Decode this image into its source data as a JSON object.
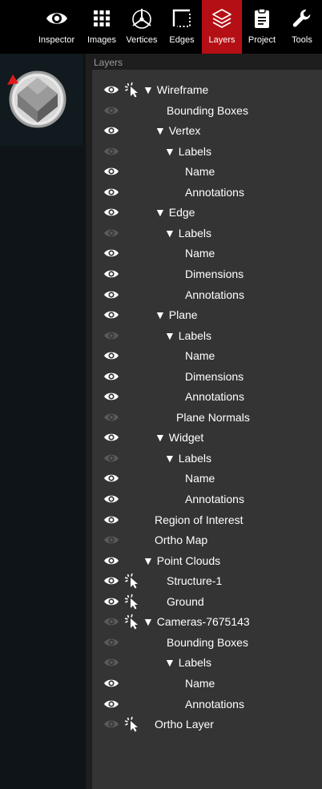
{
  "toolbar": {
    "tabs": [
      {
        "label": "Inspector",
        "icon": "eye-icon",
        "active": false
      },
      {
        "label": "Images",
        "icon": "grid-icon",
        "active": false
      },
      {
        "label": "Vertices",
        "icon": "vertices-icon",
        "active": false
      },
      {
        "label": "Edges",
        "icon": "edges-icon",
        "active": false
      },
      {
        "label": "Layers",
        "icon": "layers-icon",
        "active": true
      },
      {
        "label": "Project",
        "icon": "clipboard-icon",
        "active": false
      },
      {
        "label": "Tools",
        "icon": "wrench-icon",
        "active": false
      }
    ],
    "active_color": "#b40f14"
  },
  "layers": {
    "title": "Layers",
    "items": [
      {
        "label": "Wireframe",
        "arrow": "▼",
        "visible": true,
        "selectable": true
      },
      {
        "label": "Bounding Boxes",
        "arrow": "",
        "visible": false,
        "selectable": false
      },
      {
        "label": "Vertex",
        "arrow": "▼",
        "visible": true,
        "selectable": false
      },
      {
        "label": "Labels",
        "arrow": "▼",
        "visible": false,
        "selectable": false
      },
      {
        "label": "Name",
        "arrow": "",
        "visible": true,
        "selectable": false
      },
      {
        "label": "Annotations",
        "arrow": "",
        "visible": true,
        "selectable": false
      },
      {
        "label": "Edge",
        "arrow": "▼",
        "visible": true,
        "selectable": false
      },
      {
        "label": "Labels",
        "arrow": "▼",
        "visible": false,
        "selectable": false
      },
      {
        "label": "Name",
        "arrow": "",
        "visible": true,
        "selectable": false
      },
      {
        "label": "Dimensions",
        "arrow": "",
        "visible": true,
        "selectable": false
      },
      {
        "label": "Annotations",
        "arrow": "",
        "visible": true,
        "selectable": false
      },
      {
        "label": "Plane",
        "arrow": "▼",
        "visible": true,
        "selectable": false
      },
      {
        "label": "Labels",
        "arrow": "▼",
        "visible": false,
        "selectable": false
      },
      {
        "label": "Name",
        "arrow": "",
        "visible": true,
        "selectable": false
      },
      {
        "label": "Dimensions",
        "arrow": "",
        "visible": true,
        "selectable": false
      },
      {
        "label": "Annotations",
        "arrow": "",
        "visible": true,
        "selectable": false
      },
      {
        "label": "Plane Normals",
        "arrow": "",
        "visible": false,
        "selectable": false
      },
      {
        "label": "Widget",
        "arrow": "▼",
        "visible": true,
        "selectable": false
      },
      {
        "label": "Labels",
        "arrow": "▼",
        "visible": false,
        "selectable": false
      },
      {
        "label": "Name",
        "arrow": "",
        "visible": true,
        "selectable": false
      },
      {
        "label": "Annotations",
        "arrow": "",
        "visible": true,
        "selectable": false
      },
      {
        "label": "Region of Interest",
        "arrow": "",
        "visible": true,
        "selectable": false
      },
      {
        "label": "Ortho Map",
        "arrow": "",
        "visible": false,
        "selectable": false
      },
      {
        "label": "Point Clouds",
        "arrow": "▼",
        "visible": true,
        "selectable": false
      },
      {
        "label": "Structure-1",
        "arrow": "",
        "visible": true,
        "selectable": true
      },
      {
        "label": "Ground",
        "arrow": "",
        "visible": true,
        "selectable": true
      },
      {
        "label": "Cameras-7675143",
        "arrow": "▼",
        "visible": false,
        "selectable": true
      },
      {
        "label": "Bounding Boxes",
        "arrow": "",
        "visible": false,
        "selectable": false
      },
      {
        "label": "Labels",
        "arrow": "▼",
        "visible": false,
        "selectable": false
      },
      {
        "label": "Name",
        "arrow": "",
        "visible": true,
        "selectable": false
      },
      {
        "label": "Annotations",
        "arrow": "",
        "visible": true,
        "selectable": false
      },
      {
        "label": "Ortho Layer",
        "arrow": "",
        "visible": false,
        "selectable": true
      }
    ]
  },
  "nav_widget": {
    "icon": "view-cube-icon",
    "marker_color": "#e01b1b"
  }
}
